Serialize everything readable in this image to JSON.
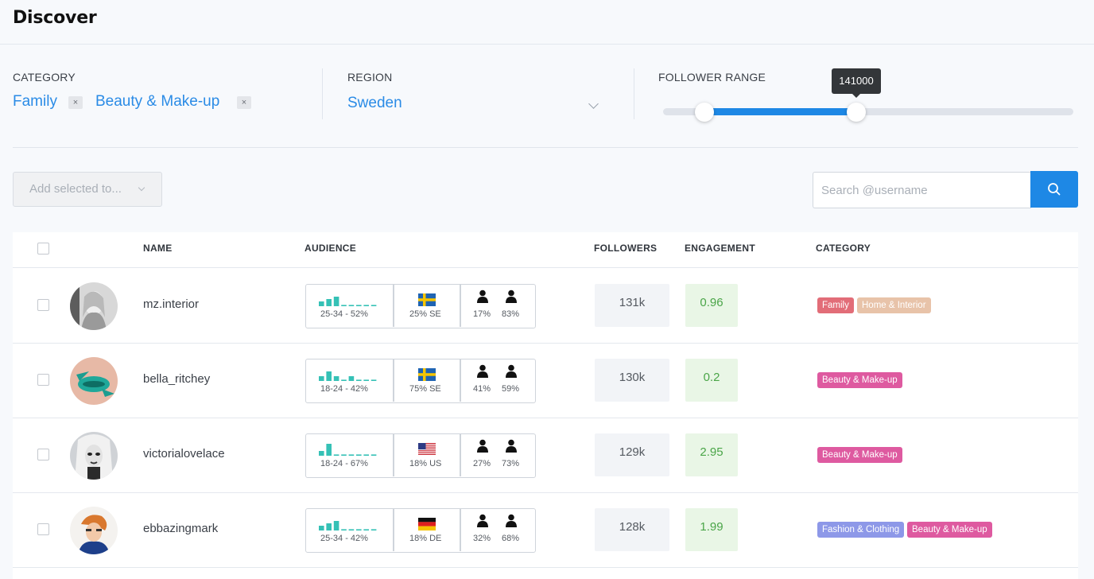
{
  "header": {
    "title": "Discover"
  },
  "filters": {
    "category": {
      "label": "CATEGORY",
      "chips": [
        "Family",
        "Beauty & Make-up"
      ],
      "remove_glyph": "×"
    },
    "region": {
      "label": "REGION",
      "value": "Sweden"
    },
    "follower_range": {
      "label": "FOLLOWER RANGE",
      "tooltip": "141000",
      "low_fraction": 0.1,
      "high_fraction": 0.47
    }
  },
  "toolbar": {
    "add_selected_label": "Add selected to...",
    "search_placeholder": "Search @username"
  },
  "table": {
    "headers": {
      "name": "NAME",
      "audience": "AUDIENCE",
      "followers": "FOLLOWERS",
      "engagement": "ENGAGEMENT",
      "category": "CATEGORY"
    },
    "rows": [
      {
        "username": "mz.interior",
        "age": "25-34 - 52%",
        "age_bars": [
          2,
          3,
          4,
          1,
          1,
          1,
          1,
          1
        ],
        "country": "25% SE",
        "flag": "SE",
        "male": "17%",
        "female": "83%",
        "followers": "131k",
        "engagement": "0.96",
        "tags": [
          {
            "label": "Family",
            "color": "#e26d78"
          },
          {
            "label": "Home & Interior",
            "color": "#e8c3a9"
          }
        ]
      },
      {
        "username": "bella_ritchey",
        "age": "18-24 - 42%",
        "age_bars": [
          2,
          4,
          2,
          1,
          2,
          1,
          1,
          1
        ],
        "country": "75% SE",
        "flag": "SE",
        "male": "41%",
        "female": "59%",
        "followers": "130k",
        "engagement": "0.2",
        "tags": [
          {
            "label": "Beauty & Make-up",
            "color": "#de5aa0"
          }
        ]
      },
      {
        "username": "victorialovelace",
        "age": "18-24 - 67%",
        "age_bars": [
          2,
          5,
          1,
          1,
          1,
          1,
          1,
          1
        ],
        "country": "18% US",
        "flag": "US",
        "male": "27%",
        "female": "73%",
        "followers": "129k",
        "engagement": "2.95",
        "tags": [
          {
            "label": "Beauty & Make-up",
            "color": "#de5aa0"
          }
        ]
      },
      {
        "username": "ebbazingmark",
        "age": "25-34 - 42%",
        "age_bars": [
          2,
          3,
          4,
          1,
          1,
          1,
          1,
          1
        ],
        "country": "18% DE",
        "flag": "DE",
        "male": "32%",
        "female": "68%",
        "followers": "128k",
        "engagement": "1.99",
        "tags": [
          {
            "label": "Fashion & Clothing",
            "color": "#8d98e8"
          },
          {
            "label": "Beauty & Make-up",
            "color": "#de5aa0"
          }
        ]
      }
    ]
  },
  "colors": {
    "accent": "#1e88e5",
    "bars": "#35c1b6"
  }
}
